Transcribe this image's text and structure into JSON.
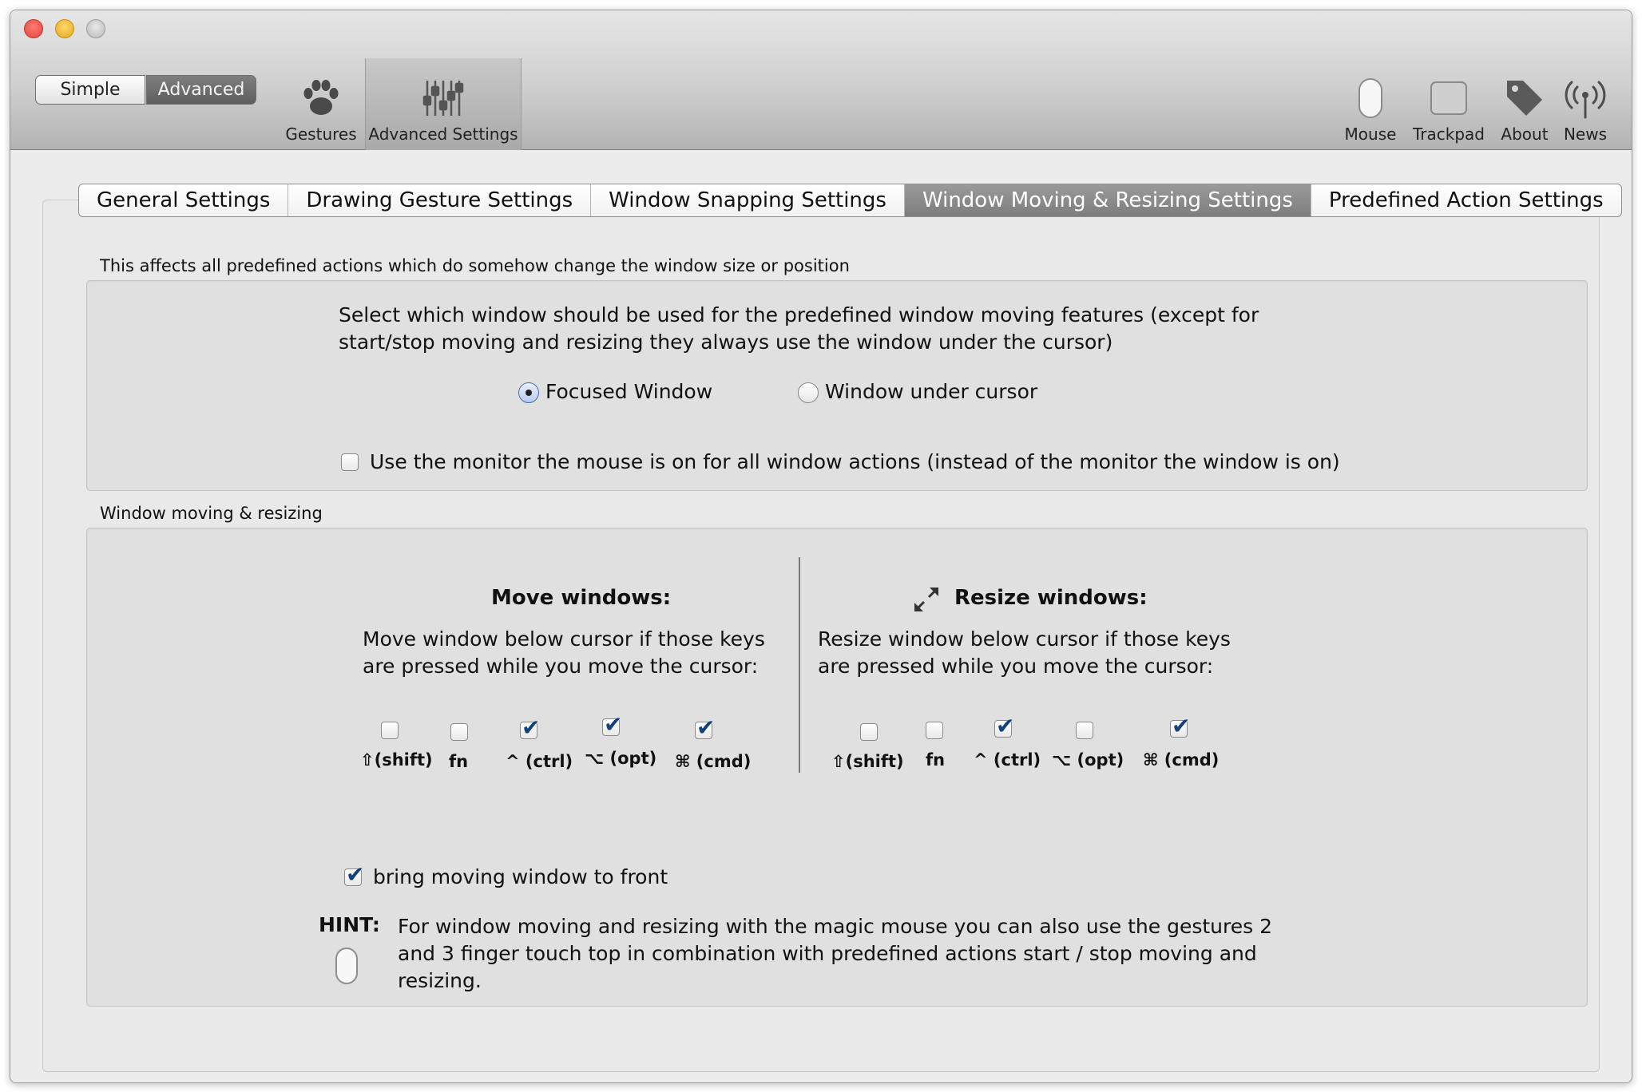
{
  "window": {
    "controls": [
      "close-button",
      "minimize-button",
      "zoom-button"
    ]
  },
  "toolbar": {
    "mode": {
      "simple": "Simple",
      "advanced": "Advanced",
      "selected": "Advanced"
    },
    "left_items": [
      {
        "label": "Gestures",
        "icon": "paw-icon"
      },
      {
        "label": "Advanced Settings",
        "icon": "sliders-icon",
        "selected": true
      }
    ],
    "right_items": [
      {
        "label": "Mouse",
        "icon": "magic-mouse-icon"
      },
      {
        "label": "Trackpad",
        "icon": "trackpad-icon"
      },
      {
        "label": "About",
        "icon": "tag-icon"
      },
      {
        "label": "News",
        "icon": "broadcast-icon"
      }
    ]
  },
  "tabs": [
    {
      "label": "General Settings"
    },
    {
      "label": "Drawing Gesture Settings"
    },
    {
      "label": "Window Snapping Settings"
    },
    {
      "label": "Window Moving & Resizing Settings",
      "active": true
    },
    {
      "label": "Predefined Action Settings"
    }
  ],
  "window_target": {
    "section_label": "This affects all predefined actions which do somehow change the window size or position",
    "description_line1": "Select which window should be used for the predefined window moving features (except for",
    "description_line2": "start/stop moving and resizing they always use the window under the cursor)",
    "options": [
      {
        "label": "Focused Window",
        "selected": true
      },
      {
        "label": "Window under cursor",
        "selected": false
      }
    ],
    "monitor_checkbox": {
      "label": "Use the monitor the mouse is on for all window actions (instead of the monitor the window is on)",
      "checked": false
    }
  },
  "moving_resizing": {
    "section_label": "Window moving & resizing",
    "move": {
      "title": "Move windows:",
      "desc_line1": "Move window below cursor if those keys",
      "desc_line2": "are pressed while you move the cursor:",
      "keys": [
        {
          "label": "⇧(shift)",
          "checked": false
        },
        {
          "label": "fn",
          "checked": false
        },
        {
          "label": "^ (ctrl)",
          "checked": true
        },
        {
          "label": "⌥ (opt)",
          "checked": true
        },
        {
          "label": "⌘ (cmd)",
          "checked": true
        }
      ]
    },
    "resize": {
      "title": "Resize windows:",
      "icon": "resize-arrows-icon",
      "desc_line1": "Resize window below cursor if those keys",
      "desc_line2": "are pressed while you move the cursor:",
      "keys": [
        {
          "label": "⇧(shift)",
          "checked": false
        },
        {
          "label": "fn",
          "checked": false
        },
        {
          "label": "^ (ctrl)",
          "checked": true
        },
        {
          "label": "⌥ (opt)",
          "checked": false
        },
        {
          "label": "⌘ (cmd)",
          "checked": true
        }
      ]
    },
    "bring_to_front": {
      "label": "bring moving window to front",
      "checked": true
    },
    "hint": {
      "title": "HINT:",
      "line1": "For window moving and resizing with the magic mouse you can also use the gestures 2",
      "line2": "and 3 finger touch top in combination with predefined actions start / stop moving and",
      "line3": "resizing."
    }
  }
}
